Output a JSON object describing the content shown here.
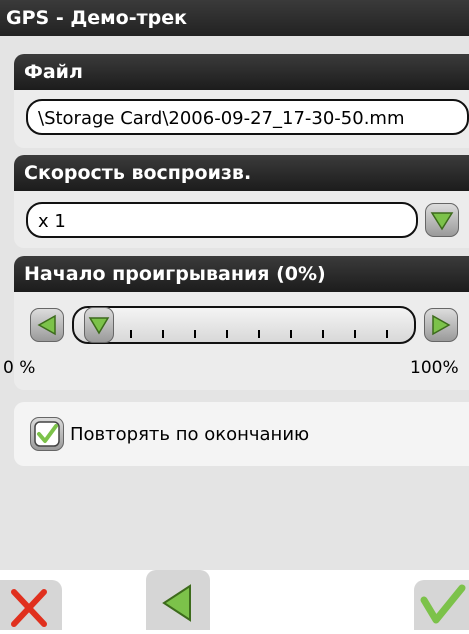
{
  "window": {
    "title": "GPS - Демо-трек"
  },
  "file": {
    "header": "Файл",
    "path": "\\Storage Card\\2006-09-27_17-30-50.mm"
  },
  "speed": {
    "header": "Скорость воспроизв.",
    "value": "x 1"
  },
  "start": {
    "header": "Начало проигрывания (0%)",
    "progress_percent": 0,
    "min_label": "0 %",
    "max_label": "100%"
  },
  "repeat": {
    "label": "Повторять по окончанию",
    "checked": true
  },
  "toolbar": {
    "cancel_icon": "close-icon",
    "back_icon": "left-arrow-icon",
    "ok_icon": "checkmark-icon"
  },
  "colors": {
    "accent_green": "#7cc24a",
    "cancel_red": "#e0301e",
    "header_dark": "#222222"
  }
}
